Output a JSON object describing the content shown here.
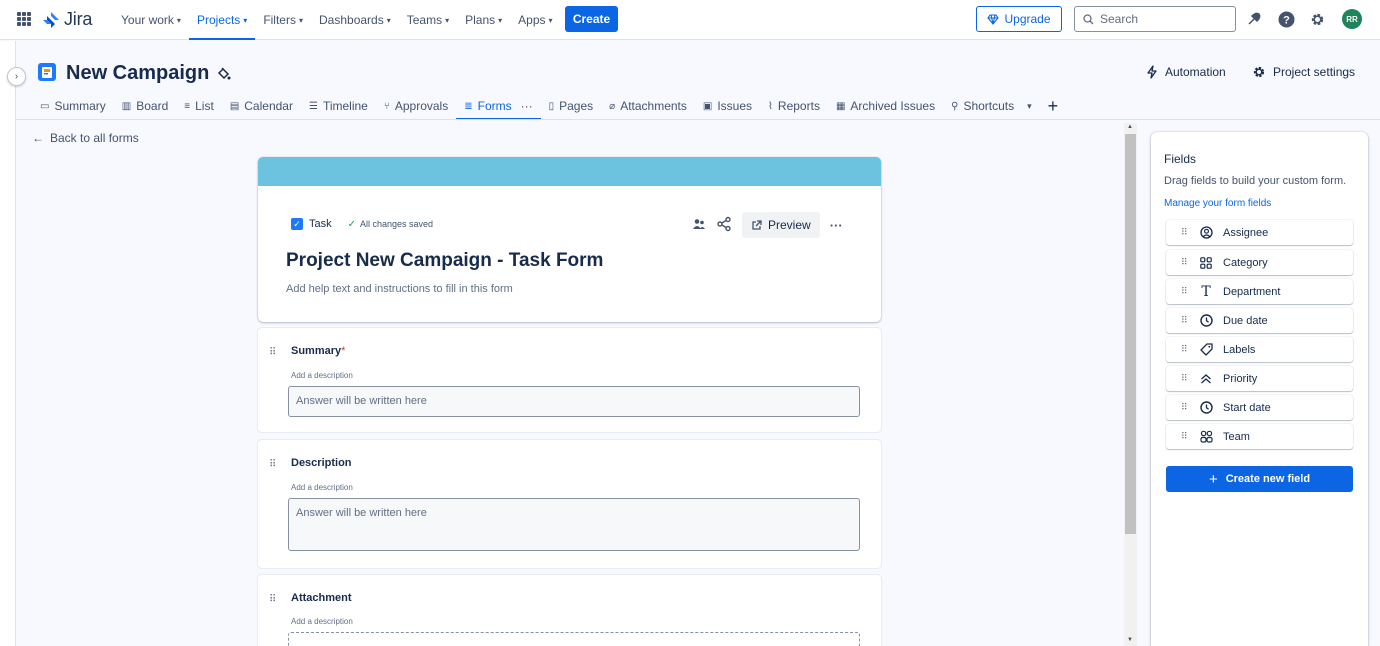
{
  "topnav": {
    "app_name": "Jira",
    "items": [
      {
        "label": "Your work",
        "active": false
      },
      {
        "label": "Projects",
        "active": true
      },
      {
        "label": "Filters",
        "active": false
      },
      {
        "label": "Dashboards",
        "active": false
      },
      {
        "label": "Teams",
        "active": false
      },
      {
        "label": "Plans",
        "active": false
      },
      {
        "label": "Apps",
        "active": false
      }
    ],
    "create_label": "Create",
    "upgrade_label": "Upgrade",
    "search_placeholder": "Search",
    "avatar_initials": "RR",
    "accent_color": "#0c66e4"
  },
  "project": {
    "title": "New Campaign",
    "automation_label": "Automation",
    "settings_label": "Project settings",
    "tabs": [
      {
        "label": "Summary",
        "icon": "summary-icon"
      },
      {
        "label": "Board",
        "icon": "board-icon"
      },
      {
        "label": "List",
        "icon": "list-icon"
      },
      {
        "label": "Calendar",
        "icon": "calendar-icon"
      },
      {
        "label": "Timeline",
        "icon": "timeline-icon"
      },
      {
        "label": "Approvals",
        "icon": "approvals-icon"
      },
      {
        "label": "Forms",
        "icon": "forms-icon",
        "active": true
      },
      {
        "label": "Pages",
        "icon": "pages-icon"
      },
      {
        "label": "Attachments",
        "icon": "attachment-icon"
      },
      {
        "label": "Issues",
        "icon": "issues-icon"
      },
      {
        "label": "Reports",
        "icon": "reports-icon"
      },
      {
        "label": "Archived Issues",
        "icon": "archive-icon"
      },
      {
        "label": "Shortcuts",
        "icon": "link-icon"
      }
    ]
  },
  "form": {
    "back_label": "Back to all forms",
    "type_label": "Task",
    "saved_label": "All changes saved",
    "preview_label": "Preview",
    "title": "Project New Campaign - Task Form",
    "help_text": "Add help text and instructions to fill in this form",
    "fields": [
      {
        "label": "Summary",
        "required": true,
        "description": "Add a description",
        "placeholder": "Answer will be written here"
      },
      {
        "label": "Description",
        "required": false,
        "description": "Add a description",
        "placeholder": "Answer will be written here"
      },
      {
        "label": "Attachment",
        "required": false,
        "description": "Add a description",
        "placeholder": ""
      }
    ]
  },
  "fields_panel": {
    "title": "Fields",
    "subtitle": "Drag fields to build your custom form.",
    "manage_link": "Manage your form fields",
    "items": [
      {
        "label": "Assignee",
        "icon": "person-icon"
      },
      {
        "label": "Category",
        "icon": "category-icon"
      },
      {
        "label": "Department",
        "icon": "text-icon"
      },
      {
        "label": "Due date",
        "icon": "clock-icon"
      },
      {
        "label": "Labels",
        "icon": "tag-icon"
      },
      {
        "label": "Priority",
        "icon": "priority-icon"
      },
      {
        "label": "Start date",
        "icon": "clock-icon"
      },
      {
        "label": "Team",
        "icon": "team-icon"
      }
    ],
    "create_label": "Create new field"
  }
}
